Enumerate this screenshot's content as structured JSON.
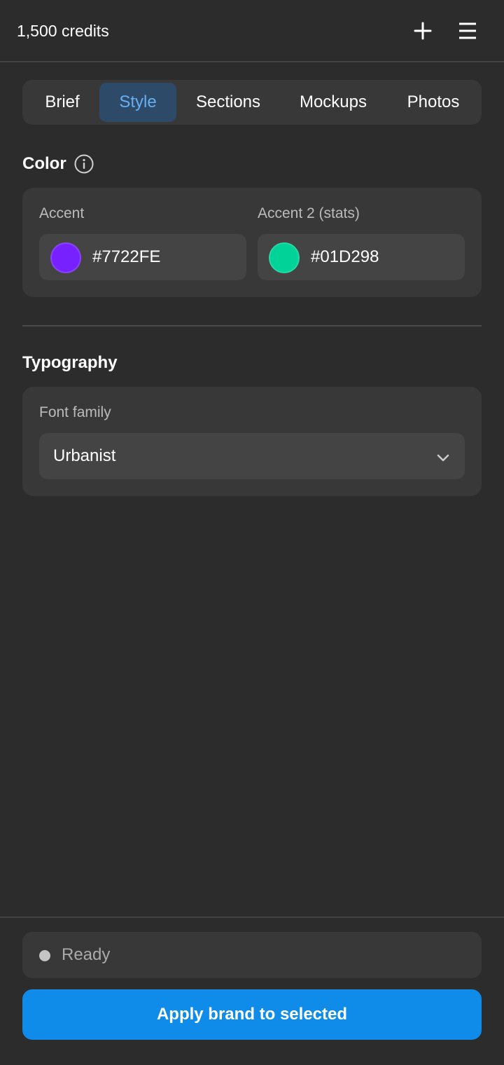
{
  "header": {
    "credits": "1,500 credits",
    "plus_icon": "plus-icon",
    "menu_icon": "hamburger-menu-icon"
  },
  "tabs": [
    {
      "label": "Brief",
      "active": false
    },
    {
      "label": "Style",
      "active": true
    },
    {
      "label": "Sections",
      "active": false
    },
    {
      "label": "Mockups",
      "active": false
    },
    {
      "label": "Photos",
      "active": false
    }
  ],
  "color": {
    "title": "Color",
    "info_icon": "info-icon",
    "accent": {
      "label": "Accent",
      "hex": "#7722FE"
    },
    "accent2": {
      "label": "Accent 2 (stats)",
      "hex": "#01D298"
    }
  },
  "typography": {
    "title": "Typography",
    "font_family_label": "Font family",
    "font_family_value": "Urbanist",
    "chevron_icon": "chevron-down-icon"
  },
  "footer": {
    "status": "Ready",
    "status_color": "#c4c4c4",
    "apply_label": "Apply brand to selected",
    "apply_color": "#0f8ce9"
  },
  "theme": {
    "background": "#2c2c2c",
    "card": "#383838",
    "field": "#444444",
    "active_tab_bg": "#2d4a69",
    "active_tab_text": "#67aff0"
  }
}
